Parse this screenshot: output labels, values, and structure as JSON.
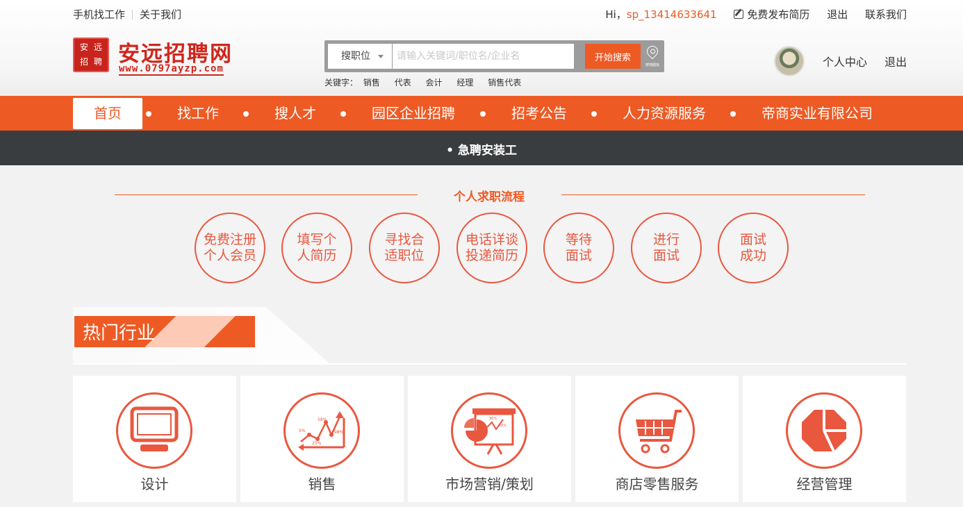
{
  "topbar": {
    "mobile_jobs": "手机找工作",
    "about_us": "关于我们",
    "greeting": "Hi，",
    "username": "sp_13414633641",
    "post_resume": "免费发布简历",
    "logout": "退出",
    "contact": "联系我们"
  },
  "logo": {
    "seal_chars": [
      "安",
      "远",
      "招",
      "聘"
    ],
    "title": "安远招聘网",
    "url": "www.0797ayzp.com"
  },
  "search": {
    "type_label": "搜职位",
    "placeholder": "请输入关键词/职位名/企业名",
    "button": "开始搜索",
    "map_label": "按地图找"
  },
  "keywords": {
    "label": "关键字：",
    "items": [
      "销售",
      "代表",
      "会计",
      "经理",
      "销售代表"
    ]
  },
  "user": {
    "center": "个人中心",
    "logout": "退出"
  },
  "nav": {
    "items": [
      "首页",
      "找工作",
      "搜人才",
      "园区企业招聘",
      "招考公告",
      "人力资源服务",
      "帝商实业有限公司"
    ]
  },
  "notice": {
    "text": "急聘安装工"
  },
  "process": {
    "title": "个人求职流程",
    "steps": [
      [
        "免费注册",
        "个人会员"
      ],
      [
        "填写个",
        "人简历"
      ],
      [
        "寻找合",
        "适职位"
      ],
      [
        "电话详谈",
        "投递简历"
      ],
      [
        "等待",
        "面试"
      ],
      [
        "进行",
        "面试"
      ],
      [
        "面试",
        "成功"
      ]
    ]
  },
  "hot": {
    "title": "热门行业",
    "industries": [
      {
        "label": "设计",
        "icon": "monitor-icon"
      },
      {
        "label": "销售",
        "icon": "line-chart-icon"
      },
      {
        "label": "市场营销/策划",
        "icon": "presentation-icon"
      },
      {
        "label": "商店零售服务",
        "icon": "shopping-cart-icon"
      },
      {
        "label": "经营管理",
        "icon": "pie-chart-icon"
      }
    ],
    "chart_labels": [
      "5%",
      "58%",
      "25%",
      "98%"
    ],
    "presentation_labels": [
      "36%",
      "50%"
    ]
  },
  "colors": {
    "accent": "#ee5a24",
    "dark_bar": "#3a3d3f",
    "logo_red": "#d0251c"
  }
}
